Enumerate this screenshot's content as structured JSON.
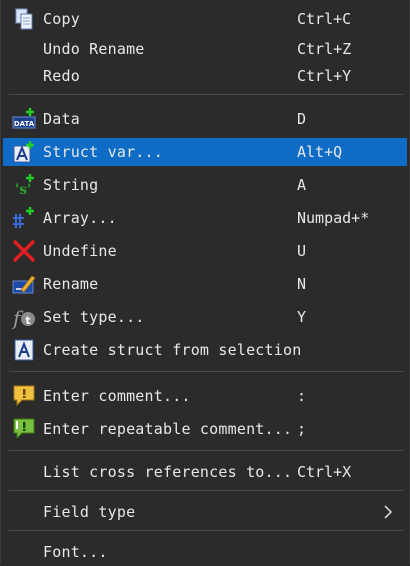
{
  "menu": {
    "items": [
      {
        "label": "Copy",
        "shortcut": "Ctrl+C",
        "icon": "copy-icon"
      },
      {
        "label": "Undo Rename",
        "shortcut": "Ctrl+Z"
      },
      {
        "label": "Redo",
        "shortcut": "Ctrl+Y"
      },
      {
        "label": "Data",
        "shortcut": "D",
        "icon": "data-icon"
      },
      {
        "label": "Struct var...",
        "shortcut": "Alt+Q",
        "icon": "struct-var-icon",
        "selected": true
      },
      {
        "label": "String",
        "shortcut": "A",
        "icon": "string-icon"
      },
      {
        "label": "Array...",
        "shortcut": "Numpad+*",
        "icon": "array-icon"
      },
      {
        "label": "Undefine",
        "shortcut": "U",
        "icon": "undefine-icon"
      },
      {
        "label": "Rename",
        "shortcut": "N",
        "icon": "rename-icon"
      },
      {
        "label": "Set type...",
        "shortcut": "Y",
        "icon": "set-type-icon"
      },
      {
        "label": "Create struct from selection",
        "shortcut": "",
        "icon": "create-struct-icon"
      },
      {
        "label": "Enter comment...",
        "shortcut": ":",
        "icon": "comment-icon"
      },
      {
        "label": "Enter repeatable comment...",
        "shortcut": ";",
        "icon": "repeatable-comment-icon"
      },
      {
        "label": "List cross references to...",
        "shortcut": "Ctrl+X"
      },
      {
        "label": "Field type",
        "shortcut": "",
        "submenu": true
      },
      {
        "label": "Font...",
        "shortcut": ""
      }
    ]
  },
  "colors": {
    "background": "#2b2b2b",
    "selected": "#0e6cc6",
    "separator": "#4a4a4a",
    "text": "#e8e8e8"
  }
}
